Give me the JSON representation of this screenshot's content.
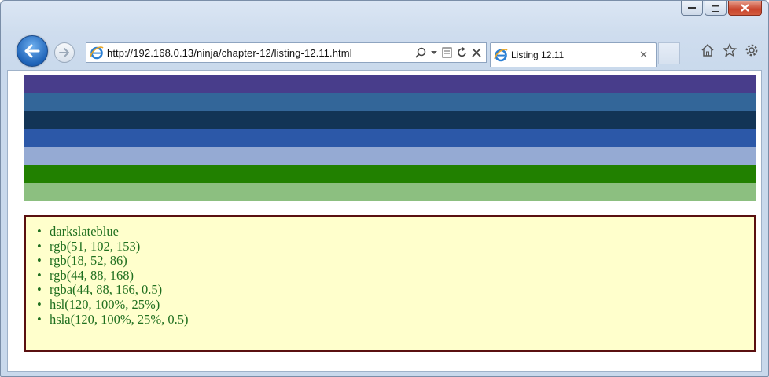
{
  "window": {
    "address_url": "http://192.168.0.13/ninja/chapter-12/listing-12.11.html",
    "tab_title": "Listing 12.11"
  },
  "stripes": [
    {
      "name": "stripe-1",
      "color": "#483d8b"
    },
    {
      "name": "stripe-2",
      "color": "#336699"
    },
    {
      "name": "stripe-3",
      "color": "#123456"
    },
    {
      "name": "stripe-4",
      "color": "#2c58a8"
    },
    {
      "name": "stripe-5",
      "color": "#95aad3"
    },
    {
      "name": "stripe-6",
      "color": "#218000"
    },
    {
      "name": "stripe-7",
      "color": "#8cbf80"
    }
  ],
  "color_list": [
    "darkslateblue",
    "rgb(51, 102, 153)",
    "rgb(18, 52, 86)",
    "rgb(44, 88, 168)",
    "rgba(44, 88, 166, 0.5)",
    "hsl(120, 100%, 25%)",
    "hsla(120, 100%, 25%, 0.5)"
  ]
}
